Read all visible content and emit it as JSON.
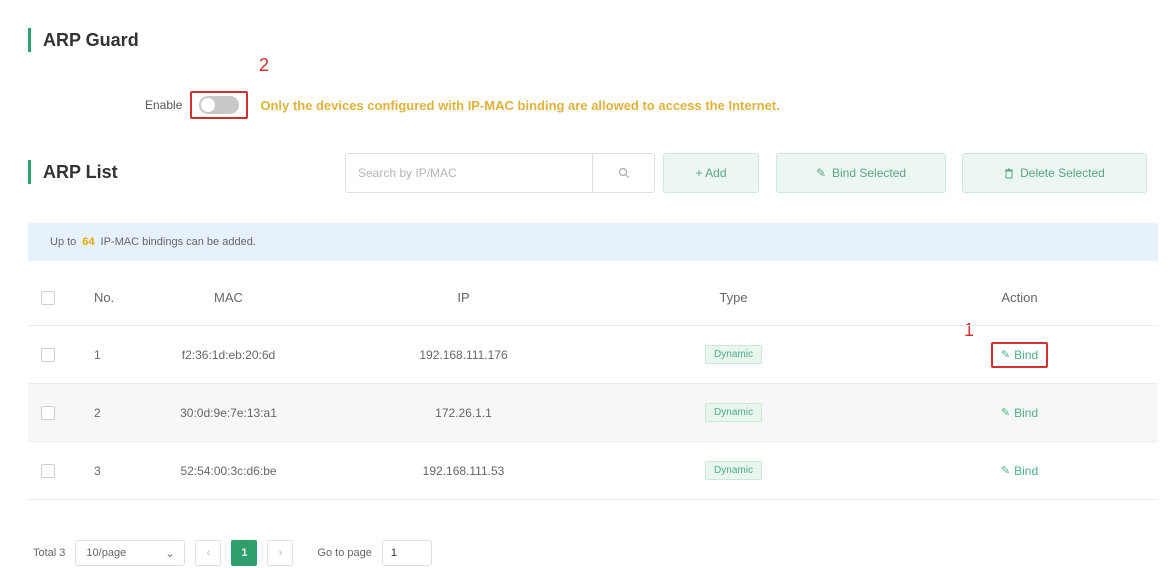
{
  "arp_guard": {
    "title": "ARP Guard",
    "enable_label": "Enable",
    "note": "Only the devices configured with IP-MAC binding are allowed to access the Internet."
  },
  "annotations": {
    "toggle_marker": "2",
    "bind_marker": "1"
  },
  "arp_list": {
    "title": "ARP List",
    "search_placeholder": "Search by IP/MAC",
    "add_label": "+ Add",
    "bind_selected_label": "Bind Selected",
    "delete_selected_label": "Delete Selected"
  },
  "info": {
    "prefix": "Up to",
    "count": "64",
    "suffix": "IP-MAC bindings can be added."
  },
  "table": {
    "headers": {
      "no": "No.",
      "mac": "MAC",
      "ip": "IP",
      "type": "Type",
      "action": "Action"
    },
    "rows": [
      {
        "no": "1",
        "mac": "f2:36:1d:eb:20:6d",
        "ip": "192.168.111.176",
        "type": "Dynamic",
        "action": "Bind"
      },
      {
        "no": "2",
        "mac": "30:0d:9e:7e:13:a1",
        "ip": "172.26.1.1",
        "type": "Dynamic",
        "action": "Bind"
      },
      {
        "no": "3",
        "mac": "52:54:00:3c:d6:be",
        "ip": "192.168.111.53",
        "type": "Dynamic",
        "action": "Bind"
      }
    ]
  },
  "pagination": {
    "total": "Total 3",
    "page_size": "10/page",
    "current_page": "1",
    "goto_label": "Go to page",
    "goto_value": "1"
  },
  "icons": {
    "search": "search-icon",
    "bind": "pencil-icon",
    "delete": "trash-icon",
    "prev": "chevron-left-icon",
    "next": "chevron-right-icon",
    "dropdown": "chevron-down-icon"
  },
  "colors": {
    "accent": "#2e9e6b",
    "warning": "#e0b23a",
    "highlight": "#d32f2f"
  }
}
